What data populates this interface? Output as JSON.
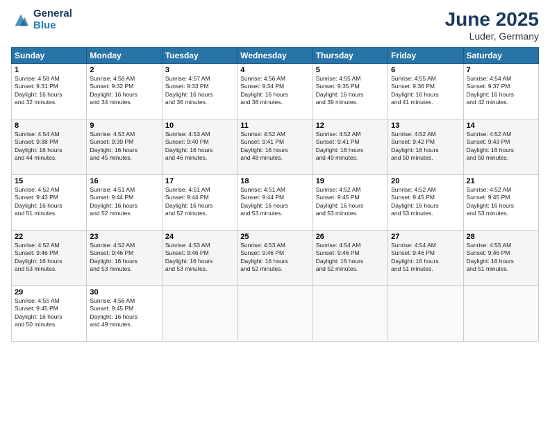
{
  "header": {
    "logo_line1": "General",
    "logo_line2": "Blue",
    "title": "June 2025",
    "subtitle": "Luder, Germany"
  },
  "columns": [
    "Sunday",
    "Monday",
    "Tuesday",
    "Wednesday",
    "Thursday",
    "Friday",
    "Saturday"
  ],
  "weeks": [
    [
      {
        "day": "1",
        "lines": [
          "Sunrise: 4:58 AM",
          "Sunset: 9:31 PM",
          "Daylight: 16 hours",
          "and 32 minutes."
        ]
      },
      {
        "day": "2",
        "lines": [
          "Sunrise: 4:58 AM",
          "Sunset: 9:32 PM",
          "Daylight: 16 hours",
          "and 34 minutes."
        ]
      },
      {
        "day": "3",
        "lines": [
          "Sunrise: 4:57 AM",
          "Sunset: 9:33 PM",
          "Daylight: 16 hours",
          "and 36 minutes."
        ]
      },
      {
        "day": "4",
        "lines": [
          "Sunrise: 4:56 AM",
          "Sunset: 9:34 PM",
          "Daylight: 16 hours",
          "and 38 minutes."
        ]
      },
      {
        "day": "5",
        "lines": [
          "Sunrise: 4:55 AM",
          "Sunset: 9:35 PM",
          "Daylight: 16 hours",
          "and 39 minutes."
        ]
      },
      {
        "day": "6",
        "lines": [
          "Sunrise: 4:55 AM",
          "Sunset: 9:36 PM",
          "Daylight: 16 hours",
          "and 41 minutes."
        ]
      },
      {
        "day": "7",
        "lines": [
          "Sunrise: 4:54 AM",
          "Sunset: 9:37 PM",
          "Daylight: 16 hours",
          "and 42 minutes."
        ]
      }
    ],
    [
      {
        "day": "8",
        "lines": [
          "Sunrise: 4:54 AM",
          "Sunset: 9:38 PM",
          "Daylight: 16 hours",
          "and 44 minutes."
        ]
      },
      {
        "day": "9",
        "lines": [
          "Sunrise: 4:53 AM",
          "Sunset: 9:39 PM",
          "Daylight: 16 hours",
          "and 45 minutes."
        ]
      },
      {
        "day": "10",
        "lines": [
          "Sunrise: 4:53 AM",
          "Sunset: 9:40 PM",
          "Daylight: 16 hours",
          "and 46 minutes."
        ]
      },
      {
        "day": "11",
        "lines": [
          "Sunrise: 4:52 AM",
          "Sunset: 9:41 PM",
          "Daylight: 16 hours",
          "and 48 minutes."
        ]
      },
      {
        "day": "12",
        "lines": [
          "Sunrise: 4:52 AM",
          "Sunset: 9:41 PM",
          "Daylight: 16 hours",
          "and 49 minutes."
        ]
      },
      {
        "day": "13",
        "lines": [
          "Sunrise: 4:52 AM",
          "Sunset: 9:42 PM",
          "Daylight: 16 hours",
          "and 50 minutes."
        ]
      },
      {
        "day": "14",
        "lines": [
          "Sunrise: 4:52 AM",
          "Sunset: 9:43 PM",
          "Daylight: 16 hours",
          "and 50 minutes."
        ]
      }
    ],
    [
      {
        "day": "15",
        "lines": [
          "Sunrise: 4:52 AM",
          "Sunset: 9:43 PM",
          "Daylight: 16 hours",
          "and 51 minutes."
        ]
      },
      {
        "day": "16",
        "lines": [
          "Sunrise: 4:51 AM",
          "Sunset: 9:44 PM",
          "Daylight: 16 hours",
          "and 52 minutes."
        ]
      },
      {
        "day": "17",
        "lines": [
          "Sunrise: 4:51 AM",
          "Sunset: 9:44 PM",
          "Daylight: 16 hours",
          "and 52 minutes."
        ]
      },
      {
        "day": "18",
        "lines": [
          "Sunrise: 4:51 AM",
          "Sunset: 9:44 PM",
          "Daylight: 16 hours",
          "and 53 minutes."
        ]
      },
      {
        "day": "19",
        "lines": [
          "Sunrise: 4:52 AM",
          "Sunset: 9:45 PM",
          "Daylight: 16 hours",
          "and 53 minutes."
        ]
      },
      {
        "day": "20",
        "lines": [
          "Sunrise: 4:52 AM",
          "Sunset: 9:45 PM",
          "Daylight: 16 hours",
          "and 53 minutes."
        ]
      },
      {
        "day": "21",
        "lines": [
          "Sunrise: 4:52 AM",
          "Sunset: 9:45 PM",
          "Daylight: 16 hours",
          "and 53 minutes."
        ]
      }
    ],
    [
      {
        "day": "22",
        "lines": [
          "Sunrise: 4:52 AM",
          "Sunset: 9:46 PM",
          "Daylight: 16 hours",
          "and 53 minutes."
        ]
      },
      {
        "day": "23",
        "lines": [
          "Sunrise: 4:52 AM",
          "Sunset: 9:46 PM",
          "Daylight: 16 hours",
          "and 53 minutes."
        ]
      },
      {
        "day": "24",
        "lines": [
          "Sunrise: 4:53 AM",
          "Sunset: 9:46 PM",
          "Daylight: 16 hours",
          "and 53 minutes."
        ]
      },
      {
        "day": "25",
        "lines": [
          "Sunrise: 4:53 AM",
          "Sunset: 9:46 PM",
          "Daylight: 16 hours",
          "and 52 minutes."
        ]
      },
      {
        "day": "26",
        "lines": [
          "Sunrise: 4:54 AM",
          "Sunset: 9:46 PM",
          "Daylight: 16 hours",
          "and 52 minutes."
        ]
      },
      {
        "day": "27",
        "lines": [
          "Sunrise: 4:54 AM",
          "Sunset: 9:46 PM",
          "Daylight: 16 hours",
          "and 51 minutes."
        ]
      },
      {
        "day": "28",
        "lines": [
          "Sunrise: 4:55 AM",
          "Sunset: 9:46 PM",
          "Daylight: 16 hours",
          "and 51 minutes."
        ]
      }
    ],
    [
      {
        "day": "29",
        "lines": [
          "Sunrise: 4:55 AM",
          "Sunset: 9:45 PM",
          "Daylight: 16 hours",
          "and 50 minutes."
        ]
      },
      {
        "day": "30",
        "lines": [
          "Sunrise: 4:56 AM",
          "Sunset: 9:45 PM",
          "Daylight: 16 hours",
          "and 49 minutes."
        ]
      },
      {
        "day": "",
        "lines": []
      },
      {
        "day": "",
        "lines": []
      },
      {
        "day": "",
        "lines": []
      },
      {
        "day": "",
        "lines": []
      },
      {
        "day": "",
        "lines": []
      }
    ]
  ]
}
